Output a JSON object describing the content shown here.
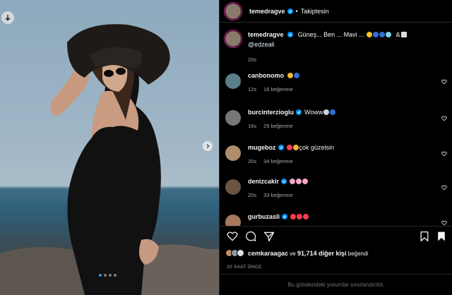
{
  "post": {
    "username": "temedragve",
    "separator": "•",
    "follow_label": "Takiptesin",
    "caption_text": "Güneş... Ben ... Mavi ...",
    "caption_mention": "@edzeali",
    "caption_time": "20s",
    "media_dots": 4,
    "active_dot": 0
  },
  "comments": [
    {
      "username": "canbonomo",
      "text": "",
      "time": "12s",
      "likes": "16 beğenme",
      "emojis": [
        "#f0b43a",
        "#2f6fd6"
      ]
    },
    {
      "username": "burcinterzioglu",
      "text": "Woww",
      "time": "16s",
      "likes": "29 beğenme",
      "emojis": [
        "#c9d3de",
        "#2f6fd6"
      ]
    },
    {
      "username": "mugeboz",
      "text": "çok güzelsin",
      "time": "20s",
      "likes": "34 beğenme",
      "emojis": [
        "#ff3b4e",
        "#f0b43a"
      ]
    },
    {
      "username": "denizcakir",
      "text": "",
      "time": "20s",
      "likes": "33 beğenme",
      "emojis": [
        "#f4a6c8",
        "#f4a6c8",
        "#f4a6c8"
      ]
    },
    {
      "username": "gurbuzasli",
      "text": "",
      "time": "",
      "likes": "",
      "emojis": [
        "#ff3b4e",
        "#ff3b4e",
        "#ff3b4e"
      ]
    }
  ],
  "likes": {
    "first_liker": "cemkaraagac",
    "joiner": "ve",
    "others": "91,714 diğer kişi",
    "suffix": "beğendi"
  },
  "timestamp": "20 SAAT ÖNCE",
  "restricted_notice": "Bu gönderideki yorumlar sınırlandırıldı.",
  "colors": {
    "accent": "#0095f6",
    "verified": "#0095f6",
    "muted": "#a8a8a8",
    "border": "#262626"
  }
}
